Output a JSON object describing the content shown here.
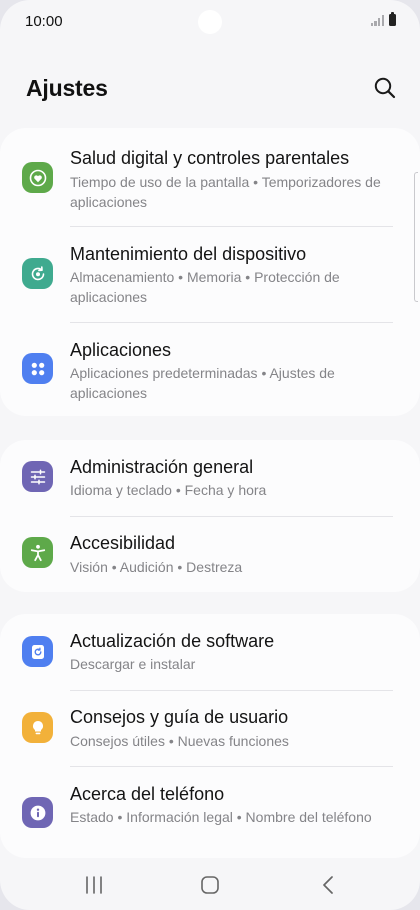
{
  "status_bar": {
    "time": "10:00"
  },
  "header": {
    "title": "Ajustes"
  },
  "colors": {
    "green": "#5ea94a",
    "teal": "#3faa8f",
    "blue": "#4f7ff0",
    "purple": "#6f66b4",
    "orange": "#f2b13a"
  },
  "groups": [
    {
      "items": [
        {
          "title": "Salud digital y controles parentales",
          "subtitle": "Tiempo de uso de la pantalla • Temporizadores de aplicaciones",
          "icon": "heart-timer-icon"
        },
        {
          "title": "Mantenimiento del dispositivo",
          "subtitle": "Almacenamiento • Memoria • Protección de aplicaciones",
          "icon": "refresh-shield-icon"
        },
        {
          "title": "Aplicaciones",
          "subtitle": "Aplicaciones predeterminadas • Ajustes de aplicaciones",
          "icon": "apps-grid-icon"
        }
      ]
    },
    {
      "items": [
        {
          "title": "Administración general",
          "subtitle": "Idioma y teclado • Fecha y hora",
          "icon": "sliders-icon"
        },
        {
          "title": "Accesibilidad",
          "subtitle": "Visión • Audición • Destreza",
          "icon": "accessibility-person-icon"
        }
      ]
    },
    {
      "items": [
        {
          "title": "Actualización de software",
          "subtitle": "Descargar e instalar",
          "icon": "software-update-icon"
        },
        {
          "title": "Consejos y guía de usuario",
          "subtitle": "Consejos útiles • Nuevas funciones",
          "icon": "lightbulb-icon"
        },
        {
          "title": "Acerca del teléfono",
          "subtitle": "Estado • Información legal • Nombre del teléfono",
          "icon": "info-icon"
        }
      ]
    }
  ],
  "nav": {
    "recents_icon": "recents-icon",
    "home_icon": "home-icon",
    "back_icon": "back-icon"
  }
}
